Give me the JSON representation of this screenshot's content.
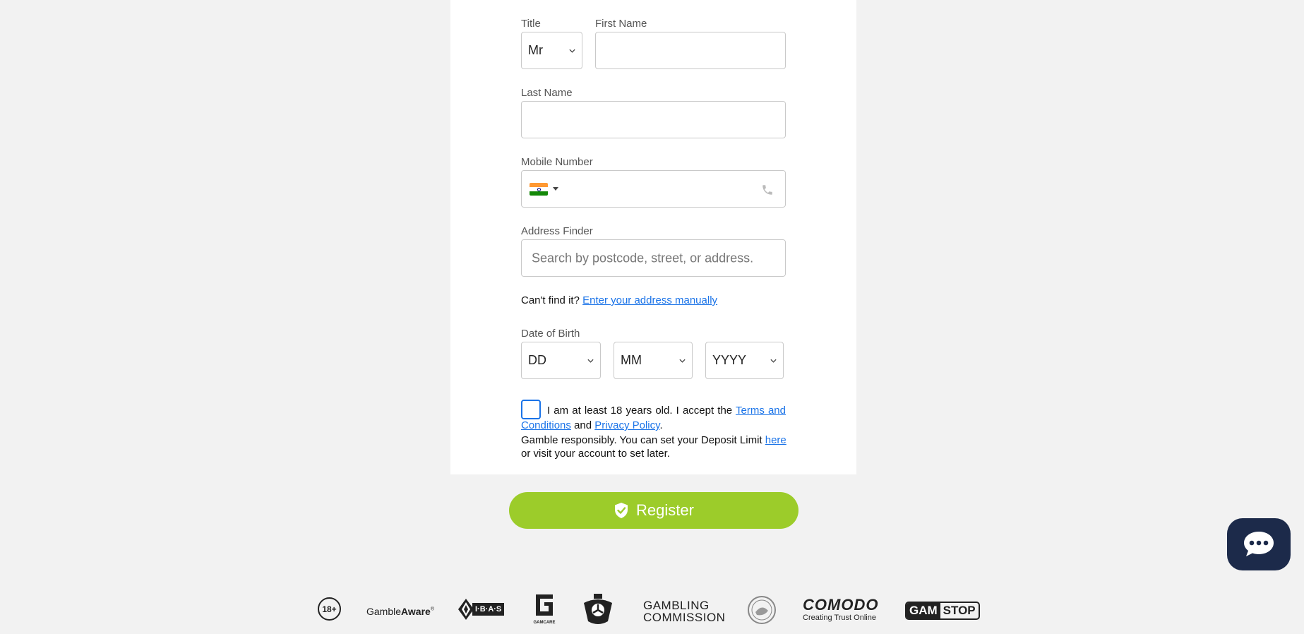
{
  "form": {
    "title_label": "Title",
    "title_value": "Mr",
    "first_name_label": "First Name",
    "first_name_value": "",
    "last_name_label": "Last Name",
    "last_name_value": "",
    "mobile_label": "Mobile Number",
    "mobile_value": "",
    "address_label": "Address Finder",
    "address_placeholder": "Search by postcode, street, or address.",
    "cant_find_text": "Can't find it?",
    "manual_link": "Enter your address manually",
    "dob_label": "Date of Birth",
    "dob_day": "DD",
    "dob_month": "MM",
    "dob_year": "YYYY",
    "consent_prefix": "I am at least 18 years old. I accept the",
    "terms_link": "Terms and Conditions",
    "consent_and": "and",
    "privacy_link": "Privacy Policy",
    "consent_end": ".",
    "gamble_text": "Gamble responsibly. You can set your Deposit Limit",
    "here_link": "here",
    "gamble_text_end": "or visit your account to set later.",
    "register_label": "Register"
  },
  "logos": {
    "age": "18+",
    "gambleaware_a": "Gamble",
    "gambleaware_b": "Aware",
    "gambleaware_reg": "®",
    "ibas": "I·B·A·S",
    "gamcare": "GAMCARE",
    "gambling_commission_1": "GAMBLING",
    "gambling_commission_2": "COMMISSION",
    "comodo": "COMODO",
    "comodo_tag": "Creating Trust Online",
    "gamstop_a": "GAM",
    "gamstop_b": "STOP"
  },
  "colors": {
    "accent_green": "#9ccc2a",
    "link_blue": "#1a73e8",
    "chat_navy": "#1c2a4a"
  },
  "icons": {
    "flag": "india-flag-icon",
    "phone": "phone-icon",
    "register": "shield-check-icon",
    "chat": "chat-bubble-icon"
  }
}
